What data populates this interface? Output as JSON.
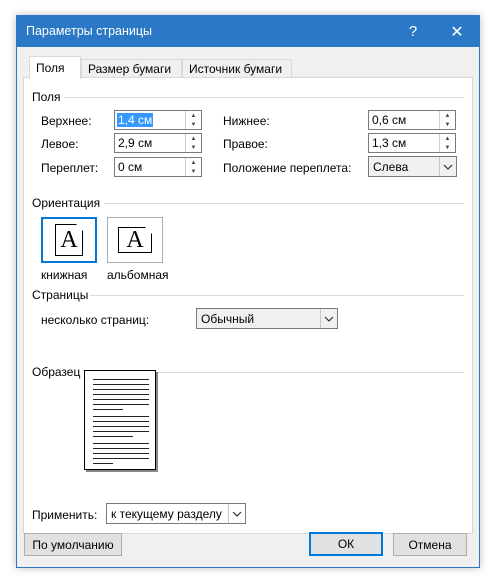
{
  "window": {
    "title": "Параметры страницы",
    "help_glyph": "?",
    "close_glyph": "✕"
  },
  "tabs": [
    {
      "label": "Поля",
      "active": true
    },
    {
      "label": "Размер бумаги",
      "active": false
    },
    {
      "label": "Источник бумаги",
      "active": false
    }
  ],
  "margins": {
    "section_title": "Поля",
    "top_label": "Верхнее:",
    "top_value": "1,4 см",
    "bottom_label": "Нижнее:",
    "bottom_value": "0,6 см",
    "left_label": "Левое:",
    "left_value": "2,9 см",
    "right_label": "Правое:",
    "right_value": "1,3 см",
    "gutter_label": "Переплет:",
    "gutter_value": "0 см",
    "gutter_pos_label": "Положение переплета:",
    "gutter_pos_value": "Слева"
  },
  "orientation": {
    "section_title": "Ориентация",
    "portrait_label": "книжная",
    "landscape_label": "альбомная",
    "icon_letter": "A",
    "selected": "portrait"
  },
  "pages": {
    "section_title": "Страницы",
    "multiple_label": "несколько страниц:",
    "multiple_value": "Обычный"
  },
  "preview": {
    "section_title": "Образец"
  },
  "apply": {
    "label": "Применить:",
    "value": "к текущему разделу"
  },
  "buttons": {
    "default_label": "По умолчанию",
    "ok_label": "ОК",
    "cancel_label": "Отмена"
  },
  "colors": {
    "titlebar": "#2b78c6",
    "focus": "#0078d7",
    "selection": "#3399ff"
  }
}
